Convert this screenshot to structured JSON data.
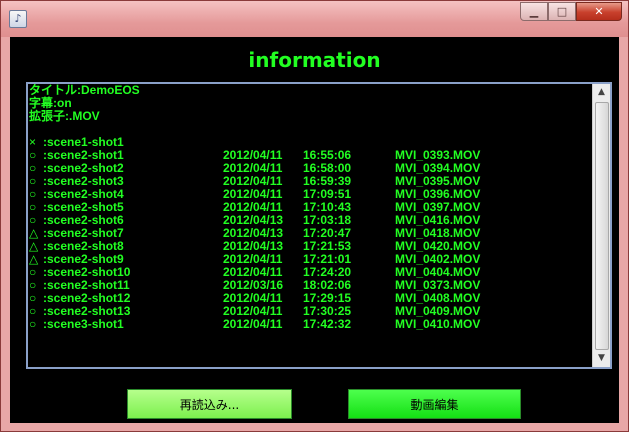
{
  "window": {
    "title": "",
    "controls": [
      "minimize",
      "maximize",
      "close"
    ]
  },
  "header": {
    "title": "information"
  },
  "info": {
    "title_line": "タイトル:DemoEOS",
    "subtitle_line": "字幕:on",
    "extension_line": "拡張子:.MOV"
  },
  "rows": [
    {
      "mark": "×",
      "scene": ":scene1-shot1",
      "date": "",
      "time": "",
      "file": ""
    },
    {
      "mark": "○",
      "scene": ":scene2-shot1",
      "date": "2012/04/11",
      "time": "16:55:06",
      "file": "MVI_0393.MOV"
    },
    {
      "mark": "○",
      "scene": ":scene2-shot2",
      "date": "2012/04/11",
      "time": "16:58:00",
      "file": "MVI_0394.MOV"
    },
    {
      "mark": "○",
      "scene": ":scene2-shot3",
      "date": "2012/04/11",
      "time": "16:59:39",
      "file": "MVI_0395.MOV"
    },
    {
      "mark": "○",
      "scene": ":scene2-shot4",
      "date": "2012/04/11",
      "time": "17:09:51",
      "file": "MVI_0396.MOV"
    },
    {
      "mark": "○",
      "scene": ":scene2-shot5",
      "date": "2012/04/11",
      "time": "17:10:43",
      "file": "MVI_0397.MOV"
    },
    {
      "mark": "○",
      "scene": ":scene2-shot6",
      "date": "2012/04/13",
      "time": "17:03:18",
      "file": "MVI_0416.MOV"
    },
    {
      "mark": "△",
      "scene": ":scene2-shot7",
      "date": "2012/04/13",
      "time": "17:20:47",
      "file": "MVI_0418.MOV"
    },
    {
      "mark": "△",
      "scene": ":scene2-shot8",
      "date": "2012/04/13",
      "time": "17:21:53",
      "file": "MVI_0420.MOV"
    },
    {
      "mark": "△",
      "scene": ":scene2-shot9",
      "date": "2012/04/11",
      "time": "17:21:01",
      "file": "MVI_0402.MOV"
    },
    {
      "mark": "○",
      "scene": ":scene2-shot10",
      "date": "2012/04/11",
      "time": "17:24:20",
      "file": "MVI_0404.MOV"
    },
    {
      "mark": "○",
      "scene": ":scene2-shot11",
      "date": "2012/03/16",
      "time": "18:02:06",
      "file": "MVI_0373.MOV"
    },
    {
      "mark": "○",
      "scene": ":scene2-shot12",
      "date": "2012/04/11",
      "time": "17:29:15",
      "file": "MVI_0408.MOV"
    },
    {
      "mark": "○",
      "scene": ":scene2-shot13",
      "date": "2012/04/11",
      "time": "17:30:25",
      "file": "MVI_0409.MOV"
    },
    {
      "mark": "○",
      "scene": ":scene3-shot1",
      "date": "2012/04/11",
      "time": "17:42:32",
      "file": "MVI_0410.MOV"
    }
  ],
  "buttons": {
    "reload": "再読込み...",
    "edit": "動画編集"
  },
  "colors": {
    "text": "#22ff22",
    "background": "#000000",
    "frame": "#e8a7a7"
  }
}
